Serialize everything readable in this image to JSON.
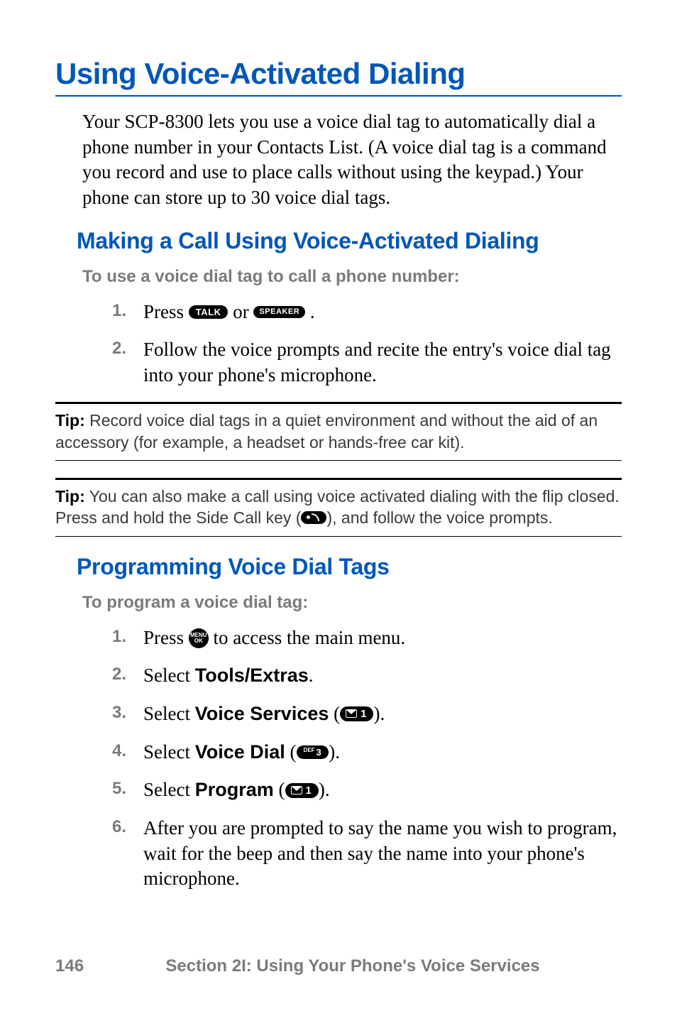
{
  "title": "Using Voice-Activated Dialing",
  "intro": "Your SCP-8300 lets you use a voice dial tag to automatically dial a phone number in your Contacts List. (A voice dial tag is a command you record and use to place calls without using the keypad.) Your phone can store up to 30 voice dial tags.",
  "sectionA": {
    "heading": "Making a Call Using Voice-Activated Dialing",
    "lead": "To use a voice dial tag to call a phone number:",
    "step1_press": "Press ",
    "step1_or": " or ",
    "step1_end": ".",
    "step2": "Follow the voice prompts and recite the entry's voice dial tag into your phone's microphone."
  },
  "key_talk": "TALK",
  "key_speaker": "SPEAKER",
  "tip_label": "Tip:",
  "tip1_text": " Record voice dial tags in a quiet environment and without the aid of an accessory (for example, a headset or hands-free car kit).",
  "tip2_text_a": " You can also make a call using voice activated dialing with the flip closed. Press and hold the Side Call key (",
  "tip2_text_b": "), and follow the voice prompts.",
  "sectionB": {
    "heading": "Programming Voice Dial Tags",
    "lead": "To program a voice dial tag:",
    "step1_a": "Press ",
    "step1_b": " to access the main menu.",
    "step2_a": "Select ",
    "step2_b": "Tools/Extras",
    "step2_c": ".",
    "step3_a": "Select ",
    "step3_b": "Voice Services",
    "step3_c": " (",
    "step3_d": ").",
    "step4_a": "Select ",
    "step4_b": "Voice Dial",
    "step4_c": " (",
    "step4_d": ").",
    "step5_a": "Select ",
    "step5_b": "Program",
    "step5_c": " (",
    "step5_d": ").",
    "step6": "After you are prompted to say the name you wish to program, wait for the beep and then say the name into your phone's microphone."
  },
  "key_menu_top": "MENU",
  "key_menu_bot": "OK",
  "key_1_num": "1",
  "key_def3_sup": "DEF",
  "key_def3_num": "3",
  "footer": {
    "page": "146",
    "section": "Section 2I: Using Your Phone's Voice Services"
  }
}
